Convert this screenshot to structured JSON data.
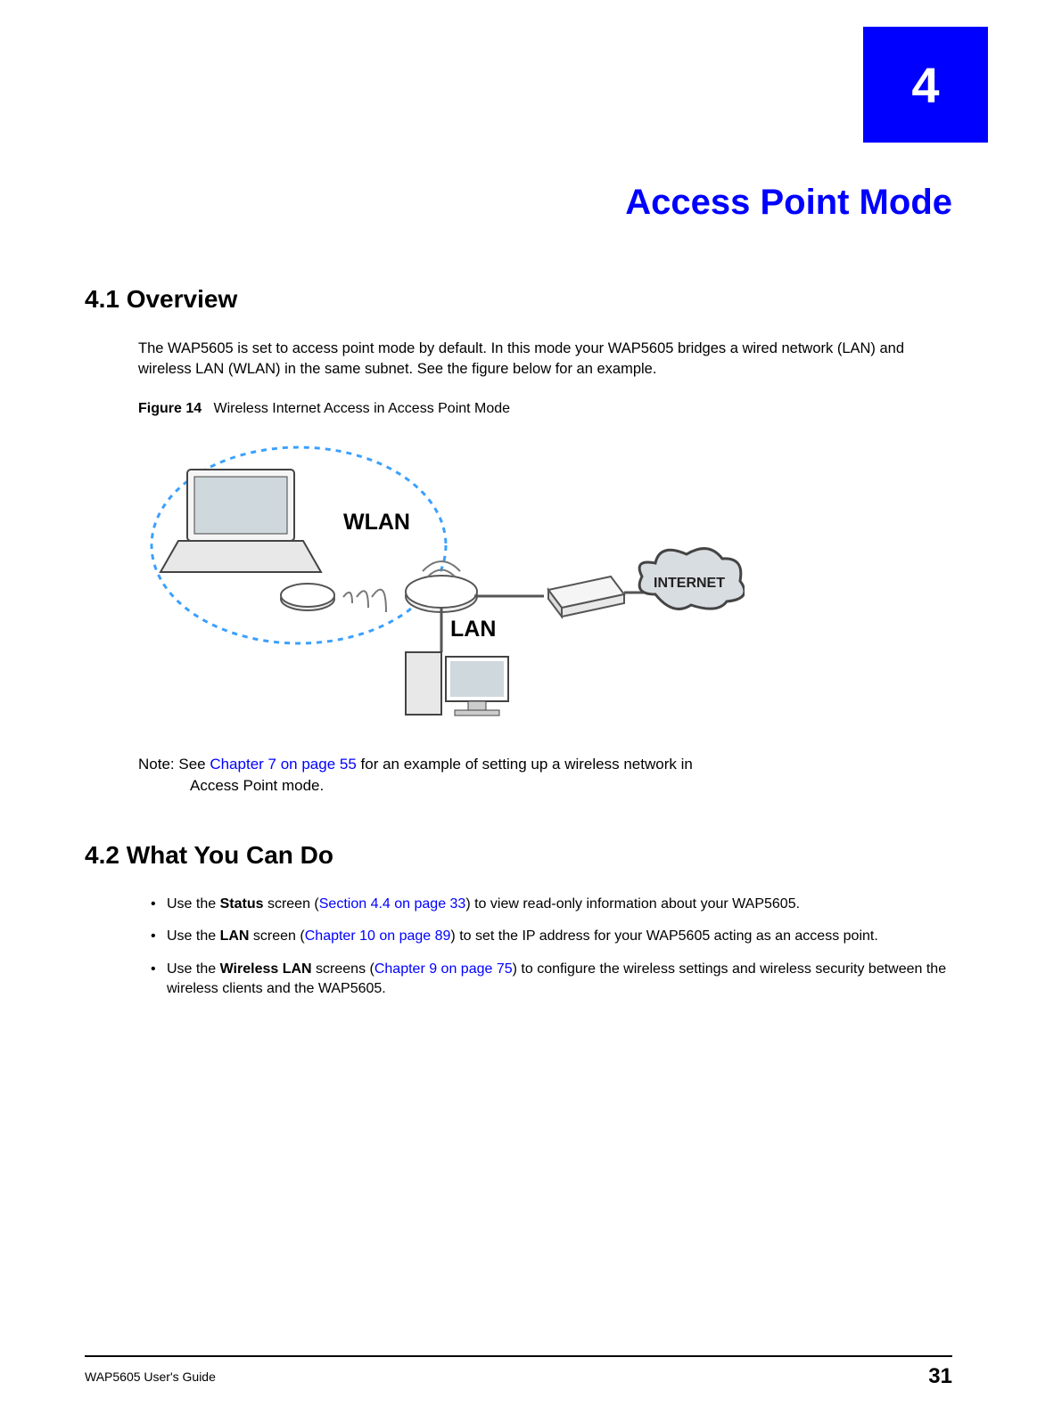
{
  "chapter": {
    "number": "4",
    "title": "Access Point Mode"
  },
  "sections": {
    "overview": {
      "heading": "4.1  Overview",
      "body": "The WAP5605 is set to access point mode by default. In this mode your WAP5605 bridges a wired network (LAN) and wireless LAN (WLAN) in the same subnet. See the figure below for an example."
    },
    "what_you_can_do": {
      "heading": "4.2  What You Can Do"
    }
  },
  "figure": {
    "label": "Figure 14",
    "caption": "Wireless Internet Access in Access Point Mode",
    "wlan_label": "WLAN",
    "lan_label": "LAN",
    "internet_label": "INTERNET"
  },
  "note": {
    "prefix": "Note: See ",
    "link": "Chapter 7 on page 55",
    "middle": " for an example of setting up a wireless network in ",
    "suffix": "Access Point mode."
  },
  "bullets": [
    {
      "pre": "Use the ",
      "bold1": "Status",
      "mid1": " screen (",
      "link": "Section 4.4 on page 33",
      "post": ") to view read-only information about your WAP5605."
    },
    {
      "pre": "Use the ",
      "bold1": "LAN",
      "mid1": " screen (",
      "link": "Chapter 10 on page 89",
      "post": ") to set the IP address for your WAP5605 acting as an access point."
    },
    {
      "pre": "Use the ",
      "bold1": "Wireless LAN",
      "mid1": " screens (",
      "link": "Chapter 9 on page 75",
      "post": ") to configure the wireless settings and wireless security between the wireless clients and the WAP5605."
    }
  ],
  "footer": {
    "guide": "WAP5605 User's Guide",
    "page": "31"
  }
}
